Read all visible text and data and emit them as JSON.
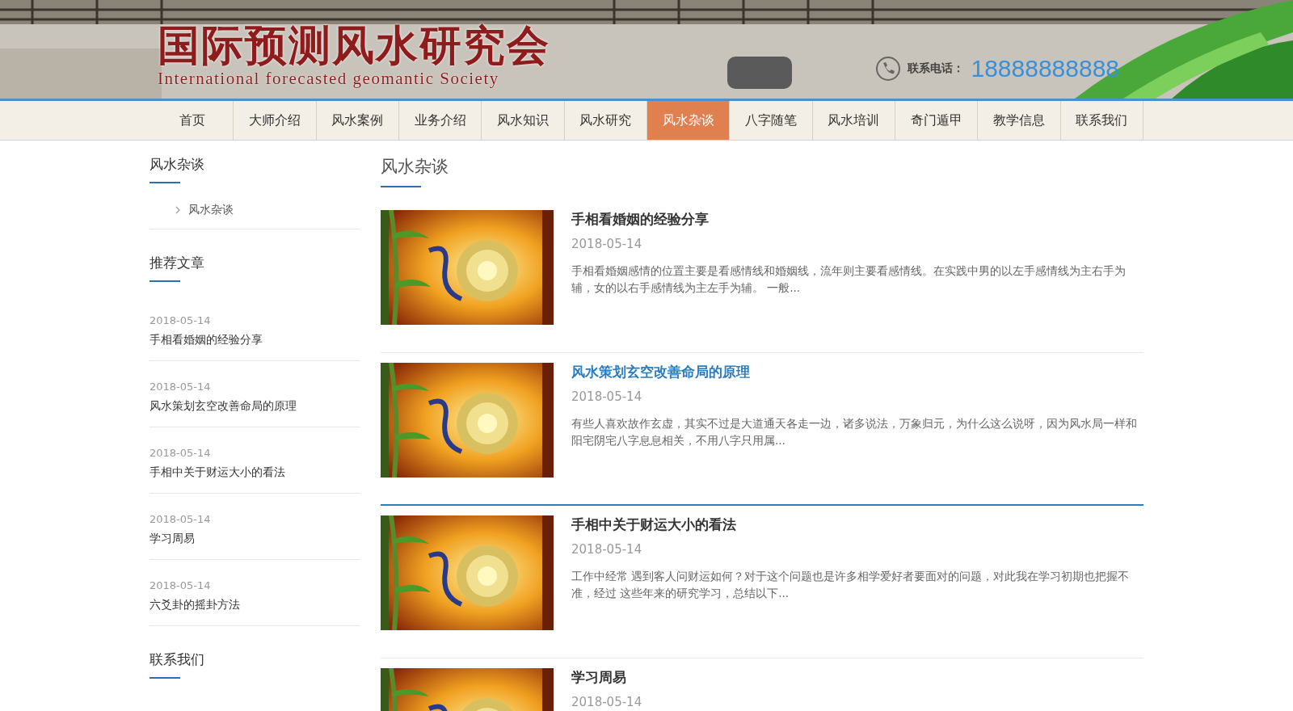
{
  "header": {
    "logo_cn": "国际预测风水研究会",
    "logo_en": "International forecasted geomantic Society",
    "phone_label": "联系电话：",
    "phone": "18888888888"
  },
  "nav": [
    {
      "label": "首页",
      "selected": false
    },
    {
      "label": "大师介绍",
      "selected": false
    },
    {
      "label": "风水案例",
      "selected": false
    },
    {
      "label": "业务介绍",
      "selected": false
    },
    {
      "label": "风水知识",
      "selected": false
    },
    {
      "label": "风水研究",
      "selected": false
    },
    {
      "label": "风水杂谈",
      "selected": true
    },
    {
      "label": "八字随笔",
      "selected": false
    },
    {
      "label": "风水培训",
      "selected": false
    },
    {
      "label": "奇门遁甲",
      "selected": false
    },
    {
      "label": "教学信息",
      "selected": false
    },
    {
      "label": "联系我们",
      "selected": false
    }
  ],
  "sidebar": {
    "category": {
      "title": "风水杂谈",
      "items": [
        "风水杂谈"
      ]
    },
    "recommended": {
      "title": "推荐文章",
      "items": [
        {
          "date": "2018-05-14",
          "title": "手相看婚姻的经验分享"
        },
        {
          "date": "2018-05-14",
          "title": "风水策划玄空改善命局的原理"
        },
        {
          "date": "2018-05-14",
          "title": "手相中关于财运大小的看法"
        },
        {
          "date": "2018-05-14",
          "title": "学习周易"
        },
        {
          "date": "2018-05-14",
          "title": "六爻卦的摇卦方法"
        }
      ]
    },
    "contact": {
      "title": "联系我们"
    }
  },
  "main": {
    "title": "风水杂谈",
    "articles": [
      {
        "title": "手相看婚姻的经验分享",
        "date": "2018-05-14",
        "summary": "手相看婚姻感情的位置主要是看感情线和婚姻线，流年则主要看感情线。在实践中男的以左手感情线为主右手为辅，女的以右手感情线为主左手为辅。 一般...",
        "highlighted": false
      },
      {
        "title": "风水策划玄空改善命局的原理",
        "date": "2018-05-14",
        "summary": "有些人喜欢故作玄虚，其实不过是大道通天各走一边，诸多说法，万象归元，为什么这么说呀，因为风水局一样和阳宅阴宅八字息息相关，不用八字只用属...",
        "highlighted": true
      },
      {
        "title": "手相中关于财运大小的看法",
        "date": "2018-05-14",
        "summary": "工作中经常 遇到客人问财运如何？对于这个问题也是许多相学爱好者要面对的问题，对此我在学习初期也把握不准，经过 这些年来的研究学习，总结以下...",
        "highlighted": false
      },
      {
        "title": "学习周易",
        "date": "2018-05-14",
        "highlighted": false
      }
    ]
  }
}
